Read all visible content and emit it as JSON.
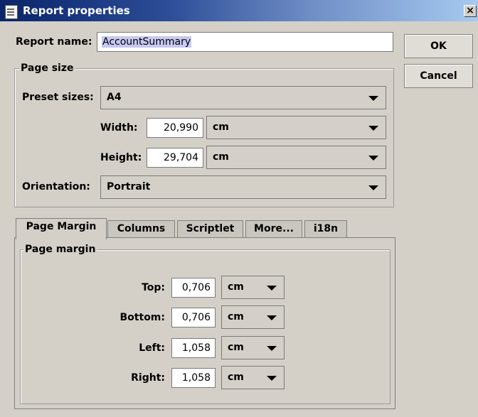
{
  "window": {
    "title": "Report properties",
    "close_glyph": "×"
  },
  "report_name": {
    "label": "Report name:",
    "value": "AccountSummary"
  },
  "buttons": {
    "ok": "OK",
    "cancel": "Cancel"
  },
  "page_size": {
    "legend": "Page size",
    "preset_label": "Preset sizes:",
    "preset_value": "A4",
    "width_label": "Width:",
    "width_value": "20,990",
    "width_unit": "cm",
    "height_label": "Height:",
    "height_value": "29,704",
    "height_unit": "cm",
    "orientation_label": "Orientation:",
    "orientation_value": "Portrait"
  },
  "tabs": [
    {
      "label": "Page Margin",
      "active": true
    },
    {
      "label": "Columns"
    },
    {
      "label": "Scriptlet"
    },
    {
      "label": "More..."
    },
    {
      "label": "i18n"
    }
  ],
  "page_margin": {
    "legend": "Page margin",
    "top": {
      "label": "Top:",
      "value": "0,706",
      "unit": "cm"
    },
    "bottom": {
      "label": "Bottom:",
      "value": "0,706",
      "unit": "cm"
    },
    "left": {
      "label": "Left:",
      "value": "1,058",
      "unit": "cm"
    },
    "right": {
      "label": "Right:",
      "value": "1,058",
      "unit": "cm"
    }
  },
  "icons": {
    "window_icon": "document-icon",
    "dropdown": "chevron-down-icon"
  }
}
